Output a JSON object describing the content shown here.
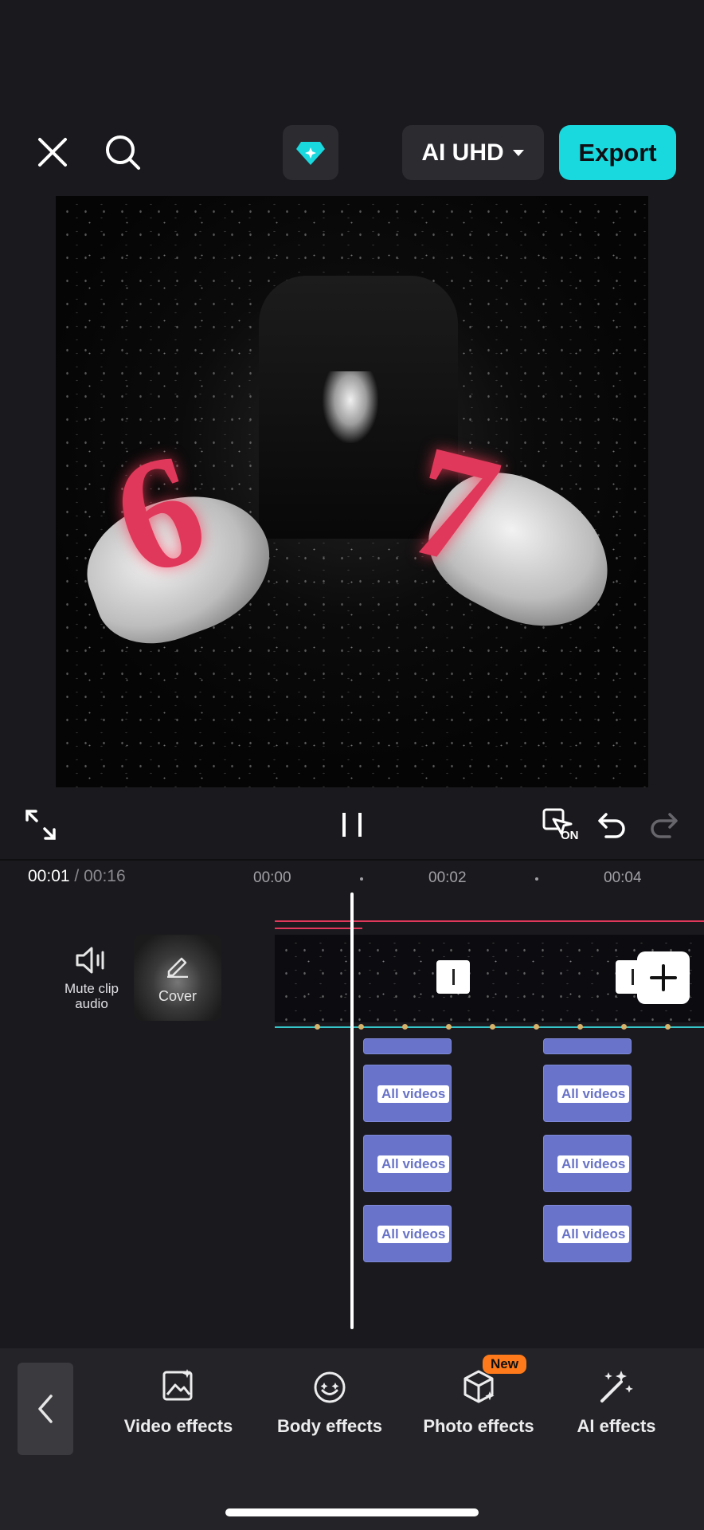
{
  "top_bar": {
    "close_icon": "close-icon",
    "search_icon": "search-icon",
    "premium_icon": "diamond-icon",
    "quality_label": "AI UHD",
    "export_label": "Export",
    "accent_color": "#19d9de"
  },
  "preview": {
    "overlay_left": "6",
    "overlay_right": "7",
    "overlay_color": "#e0385a"
  },
  "controls": {
    "fullscreen_icon": "fullscreen-icon",
    "pause_icon": "pause-icon",
    "keyframe_icon": "keyframe-on-icon",
    "keyframe_badge": "ON",
    "undo_icon": "undo-icon",
    "redo_icon": "redo-icon"
  },
  "timeline": {
    "current_time": "00:01",
    "separator": "/",
    "duration": "00:16",
    "ruler": [
      "00:00",
      "00:02",
      "00:04"
    ],
    "mute_label": "Mute clip audio",
    "cover_label": "Cover",
    "placeholder_label": "All videos"
  },
  "toolbar": {
    "items": [
      {
        "label": "Video effects",
        "icon": "video-effects-icon"
      },
      {
        "label": "Body effects",
        "icon": "body-effects-icon"
      },
      {
        "label": "Photo effects",
        "icon": "photo-effects-icon"
      },
      {
        "label": "AI effects",
        "icon": "ai-effects-icon"
      }
    ],
    "new_badge": "New"
  }
}
